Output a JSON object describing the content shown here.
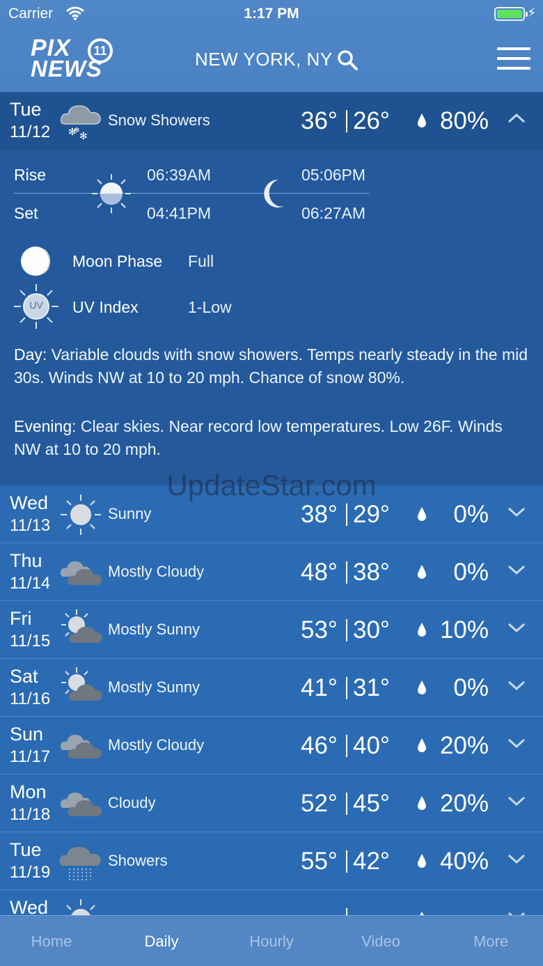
{
  "status": {
    "carrier": "Carrier",
    "time": "1:17 PM"
  },
  "header": {
    "logo_line1": "PIX",
    "logo_badge": "11",
    "logo_line2": "NEWS",
    "location": "NEW YORK, NY"
  },
  "expanded_day": {
    "dow": "Tue",
    "date": "11/12",
    "condition": "Snow Showers",
    "icon": "snow-cloud-icon",
    "hi": "36°",
    "lo": "26°",
    "precip": "80%",
    "rise_label": "Rise",
    "set_label": "Set",
    "sunrise": "06:39AM",
    "sunset": "04:41PM",
    "moonrise": "05:06PM",
    "moonset": "06:27AM",
    "moon_phase_label": "Moon Phase",
    "moon_phase_value": "Full",
    "uv_label": "UV Index",
    "uv_value": "1-Low",
    "uv_icon_text": "UV",
    "day_label": "Day",
    "day_text": ": Variable clouds with snow showers. Temps nearly steady in the mid 30s. Winds NW at 10 to 20 mph. Chance of snow 80%.",
    "evening_label": "Evening",
    "evening_text": ": Clear skies. Near record low temperatures. Low 26F. Winds NW at 10 to 20 mph."
  },
  "watermark": "UpdateStar.com",
  "days": [
    {
      "dow": "Wed",
      "date": "11/13",
      "condition": "Sunny",
      "icon": "sun-icon",
      "hi": "38°",
      "lo": "29°",
      "precip": "0%"
    },
    {
      "dow": "Thu",
      "date": "11/14",
      "condition": "Mostly Cloudy",
      "icon": "cloudy-icon",
      "hi": "48°",
      "lo": "38°",
      "precip": "0%"
    },
    {
      "dow": "Fri",
      "date": "11/15",
      "condition": "Mostly Sunny",
      "icon": "partly-sunny-icon",
      "hi": "53°",
      "lo": "30°",
      "precip": "10%"
    },
    {
      "dow": "Sat",
      "date": "11/16",
      "condition": "Mostly Sunny",
      "icon": "partly-sunny-icon",
      "hi": "41°",
      "lo": "31°",
      "precip": "0%"
    },
    {
      "dow": "Sun",
      "date": "11/17",
      "condition": "Mostly Cloudy",
      "icon": "cloudy-icon",
      "hi": "46°",
      "lo": "40°",
      "precip": "20%"
    },
    {
      "dow": "Mon",
      "date": "11/18",
      "condition": "Cloudy",
      "icon": "cloudy-icon",
      "hi": "52°",
      "lo": "45°",
      "precip": "20%"
    },
    {
      "dow": "Tue",
      "date": "11/19",
      "condition": "Showers",
      "icon": "rain-cloud-icon",
      "hi": "55°",
      "lo": "42°",
      "precip": "40%"
    },
    {
      "dow": "Wed",
      "date": "",
      "condition": "",
      "icon": "sun-icon",
      "hi": "",
      "lo": "",
      "precip": ""
    }
  ],
  "tabs": [
    {
      "label": "Home",
      "active": false
    },
    {
      "label": "Daily",
      "active": true
    },
    {
      "label": "Hourly",
      "active": false
    },
    {
      "label": "Video",
      "active": false
    },
    {
      "label": "More",
      "active": false
    }
  ]
}
